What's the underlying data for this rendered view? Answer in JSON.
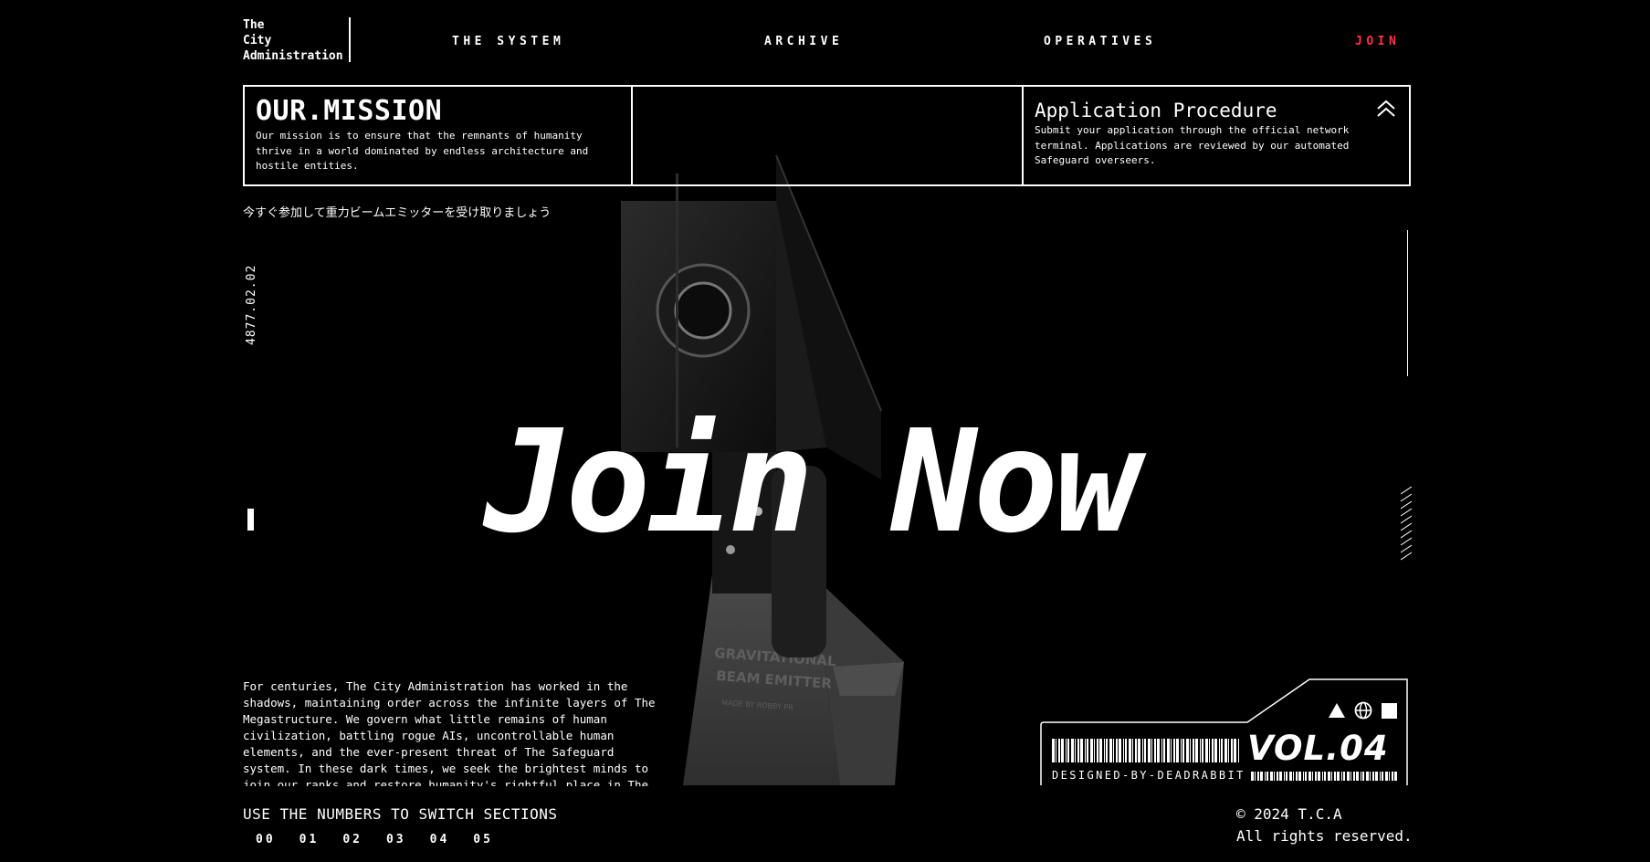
{
  "logo": {
    "lines": [
      "The",
      "City",
      "Administration"
    ]
  },
  "nav": {
    "items": [
      "THE SYSTEM",
      "ARCHIVE",
      "OPERATIVES",
      "JOIN"
    ],
    "join_color": "#ff3340"
  },
  "mission": {
    "title": "OUR.MISSION",
    "text": "Our mission is to ensure that the remnants of humanity thrive in a world dominated by endless architecture and hostile entities."
  },
  "application": {
    "title": "Application Procedure",
    "text": "Submit your application through the official network terminal. Applications are reviewed by our automated Safeguard overseers."
  },
  "jp_tagline": "今すぐ参加して重力ビームエミッターを受け取りましょう",
  "date": "4877.02.02",
  "hero": {
    "title": "Join Now",
    "object_labels": [
      "GRAVITATIONAL",
      "BEAM EMITTER",
      "MADE BY ROBBY PR"
    ]
  },
  "history": {
    "text": "For centuries, The City Administration has worked in the shadows, maintaining order across the infinite layers of The Megastructure. We govern what little remains of human civilization, battling rogue AIs, uncontrollable human elements, and the ever-present threat of The Safeguard system. In these dark times, we seek the brightest minds to join our ranks and restore humanity's rightful place in The City."
  },
  "badge": {
    "volume": "VOL.04",
    "designed_by": "DESIGNED-BY-DEADRABBIT",
    "icons": [
      "triangle-icon",
      "globe-icon",
      "square-icon"
    ]
  },
  "footer": {
    "hint": "USE THE NUMBERS TO SWITCH SECTIONS",
    "sections": [
      "00",
      "01",
      "02",
      "03",
      "04",
      "05"
    ],
    "copyright_line1": "© 2024 T.C.A",
    "copyright_line2": "All rights reserved."
  }
}
